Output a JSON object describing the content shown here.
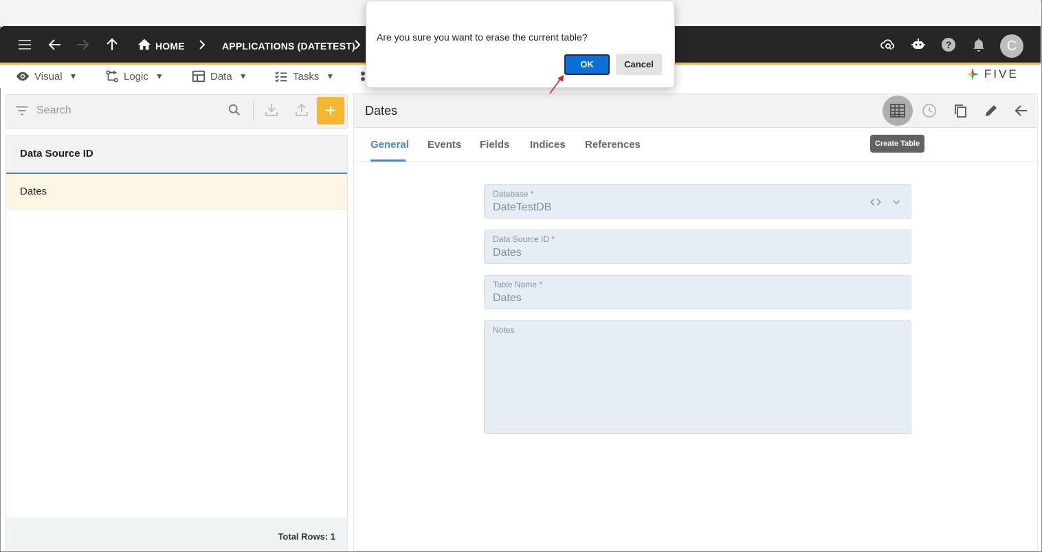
{
  "nav": {
    "breadcrumb_home": "HOME",
    "breadcrumb_app": "APPLICATIONS (DATETEST)",
    "avatar_letter": "C"
  },
  "menu": {
    "visual": "Visual",
    "logic": "Logic",
    "data": "Data",
    "tasks": "Tasks",
    "caret": "▼"
  },
  "brand": {
    "logo_text": "FIVE"
  },
  "left": {
    "search_placeholder": "Search",
    "add_label": "+",
    "column_header": "Data Source ID",
    "rows": [
      "Dates"
    ],
    "total_rows": "Total Rows: 1"
  },
  "right": {
    "title": "Dates",
    "tooltip": "Create Table",
    "tabs": [
      "General",
      "Events",
      "Fields",
      "Indices",
      "References"
    ],
    "fields": {
      "database_label": "Database *",
      "database_value": "DateTestDB",
      "dsid_label": "Data Source ID *",
      "dsid_value": "Dates",
      "table_label": "Table Name *",
      "table_value": "Dates",
      "notes_label": "Notes",
      "notes_value": ""
    }
  },
  "dialog": {
    "message": "Are you sure you want to erase the current table?",
    "ok_label": "OK",
    "cancel_label": "Cancel"
  },
  "colors": {
    "accent_orange": "#f5b731",
    "header_dark": "#262626",
    "tab_blue": "#4a86c8",
    "ok_blue": "#0b6fd6",
    "annotation_red": "#e02020"
  }
}
